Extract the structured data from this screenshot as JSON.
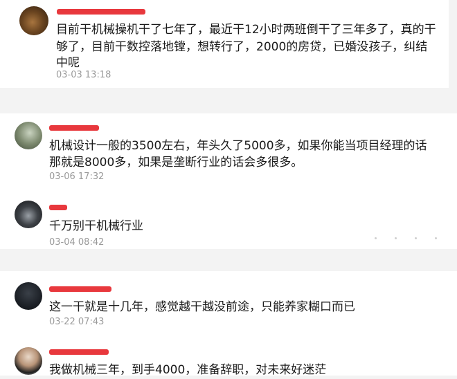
{
  "comments": [
    {
      "lines": [
        "目前干机械操机干了七年了，最近干12小时两班倒干了三年多了，真的干",
        "够了，目前干数控落地镗，想转行了，2000的房贷，已婚没孩子，纠结",
        "中呢"
      ],
      "time": "03-03 13:18"
    },
    {
      "lines": [
        "机械设计一般的3500左右，年头久了5000多，如果你能当项目经理的话",
        "那就是8000多，如果是垄断行业的话会多很多。"
      ],
      "time": "03-06 17:32"
    },
    {
      "lines": [
        "千万别干机械行业"
      ],
      "time": "03-04 08:42"
    },
    {
      "lines": [
        "这一干就是十几年，感觉越干越没前途，只能养家糊口而已"
      ],
      "time": "03-22 07:43"
    },
    {
      "lines": [
        "我做机械三年，到手4000，准备辞职，对未来好迷茫"
      ],
      "time": ""
    }
  ],
  "colors": {
    "redaction": "#e8383d",
    "timestamp": "#9a9a9a",
    "text": "#1a1a1a"
  },
  "icons": [
    "avatar-dog",
    "avatar-plant",
    "avatar-car",
    "avatar-dark",
    "avatar-person"
  ]
}
